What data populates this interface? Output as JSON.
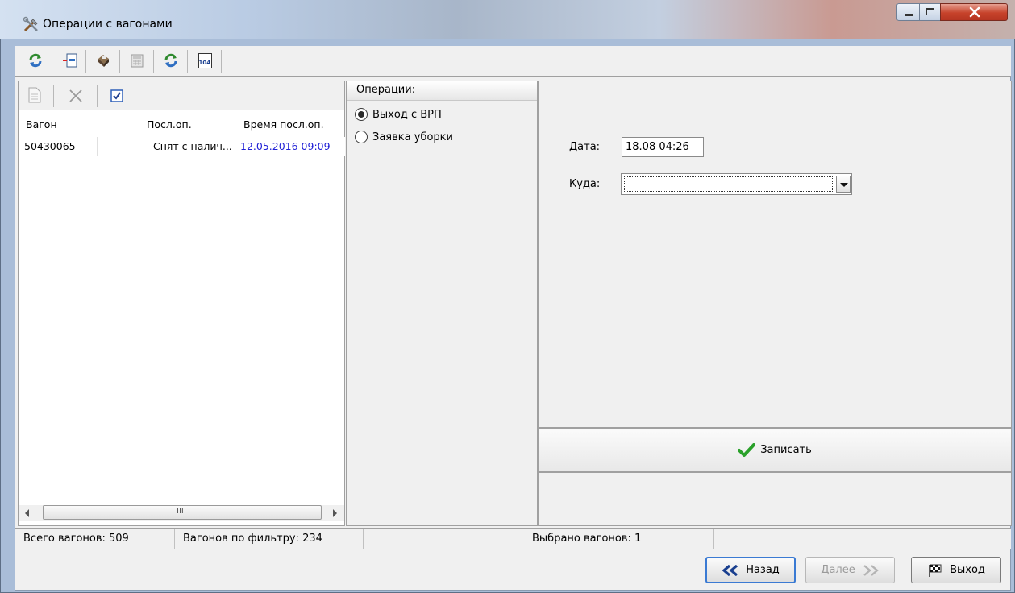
{
  "window": {
    "title": "Операции с вагонами"
  },
  "toolbar": {
    "icons": [
      "refresh-icon",
      "import-icon",
      "print-icon",
      "calculator-icon",
      "refresh-icon",
      "form-104-icon"
    ],
    "form_label": "104"
  },
  "left": {
    "columns": [
      "Вагон",
      "Посл.оп.",
      "Время посл.оп."
    ],
    "rows": [
      {
        "wagon": "50430065",
        "last_op": "Снят с налич...",
        "time": "12.05.2016 09:09"
      }
    ],
    "scroll_mark": "III"
  },
  "operations": {
    "header": "Операции:",
    "options": [
      {
        "label": "Выход с ВРП",
        "selected": true
      },
      {
        "label": "Заявка уборки",
        "selected": false
      }
    ]
  },
  "form": {
    "date_label": "Дата:",
    "date_value": "18.08 04:26",
    "dest_label": "Куда:",
    "dest_value": "",
    "save_label": "Записать"
  },
  "status": {
    "total": "Всего вагонов: 509",
    "filtered": "Вагонов по фильтру: 234",
    "selected": "Выбрано вагонов: 1"
  },
  "buttons": {
    "back": "Назад",
    "next": "Далее",
    "exit": "Выход"
  },
  "colors": {
    "time_text": "#1f1fd6",
    "save_check": "#2aa12a",
    "nav_arrows": "#1a3f8f"
  }
}
